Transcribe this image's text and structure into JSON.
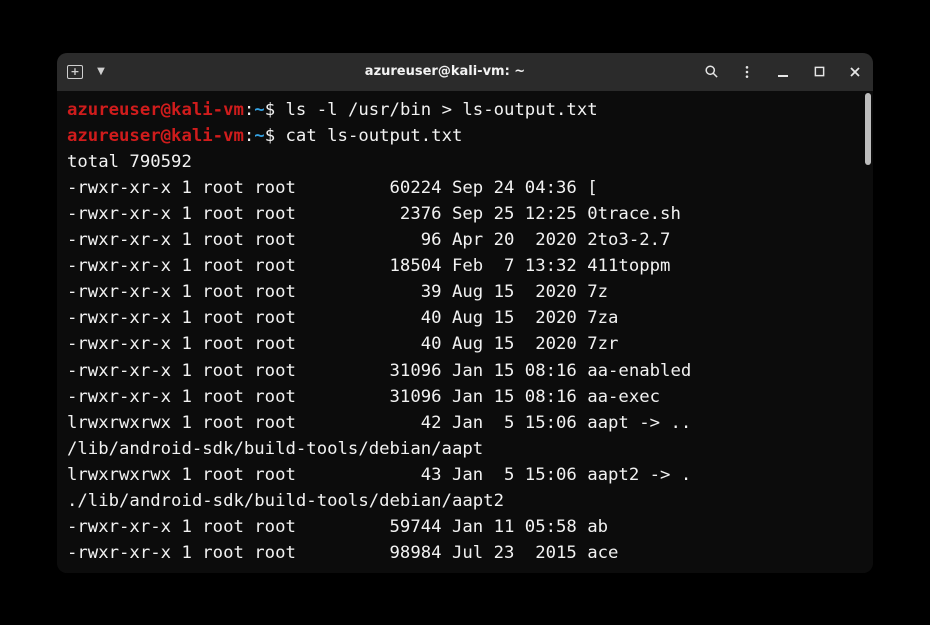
{
  "window": {
    "title": "azureuser@kali-vm: ~"
  },
  "prompt": {
    "user": "azureuser",
    "at": "@",
    "host": "kali-vm",
    "colon": ":",
    "path": "~",
    "symbol": "$"
  },
  "commands": [
    "ls -l /usr/bin > ls-output.txt",
    "cat ls-output.txt"
  ],
  "output": {
    "total_line": "total 790592",
    "lines": [
      "-rwxr-xr-x 1 root root         60224 Sep 24 04:36 [",
      "-rwxr-xr-x 1 root root          2376 Sep 25 12:25 0trace.sh",
      "-rwxr-xr-x 1 root root            96 Apr 20  2020 2to3-2.7",
      "-rwxr-xr-x 1 root root         18504 Feb  7 13:32 411toppm",
      "-rwxr-xr-x 1 root root            39 Aug 15  2020 7z",
      "-rwxr-xr-x 1 root root            40 Aug 15  2020 7za",
      "-rwxr-xr-x 1 root root            40 Aug 15  2020 7zr",
      "-rwxr-xr-x 1 root root         31096 Jan 15 08:16 aa-enabled",
      "-rwxr-xr-x 1 root root         31096 Jan 15 08:16 aa-exec",
      "lrwxrwxrwx 1 root root            42 Jan  5 15:06 aapt -> ..",
      "/lib/android-sdk/build-tools/debian/aapt",
      "lrwxrwxrwx 1 root root            43 Jan  5 15:06 aapt2 -> .",
      "./lib/android-sdk/build-tools/debian/aapt2",
      "-rwxr-xr-x 1 root root         59744 Jan 11 05:58 ab",
      "-rwxr-xr-x 1 root root         98984 Jul 23  2015 ace"
    ]
  }
}
